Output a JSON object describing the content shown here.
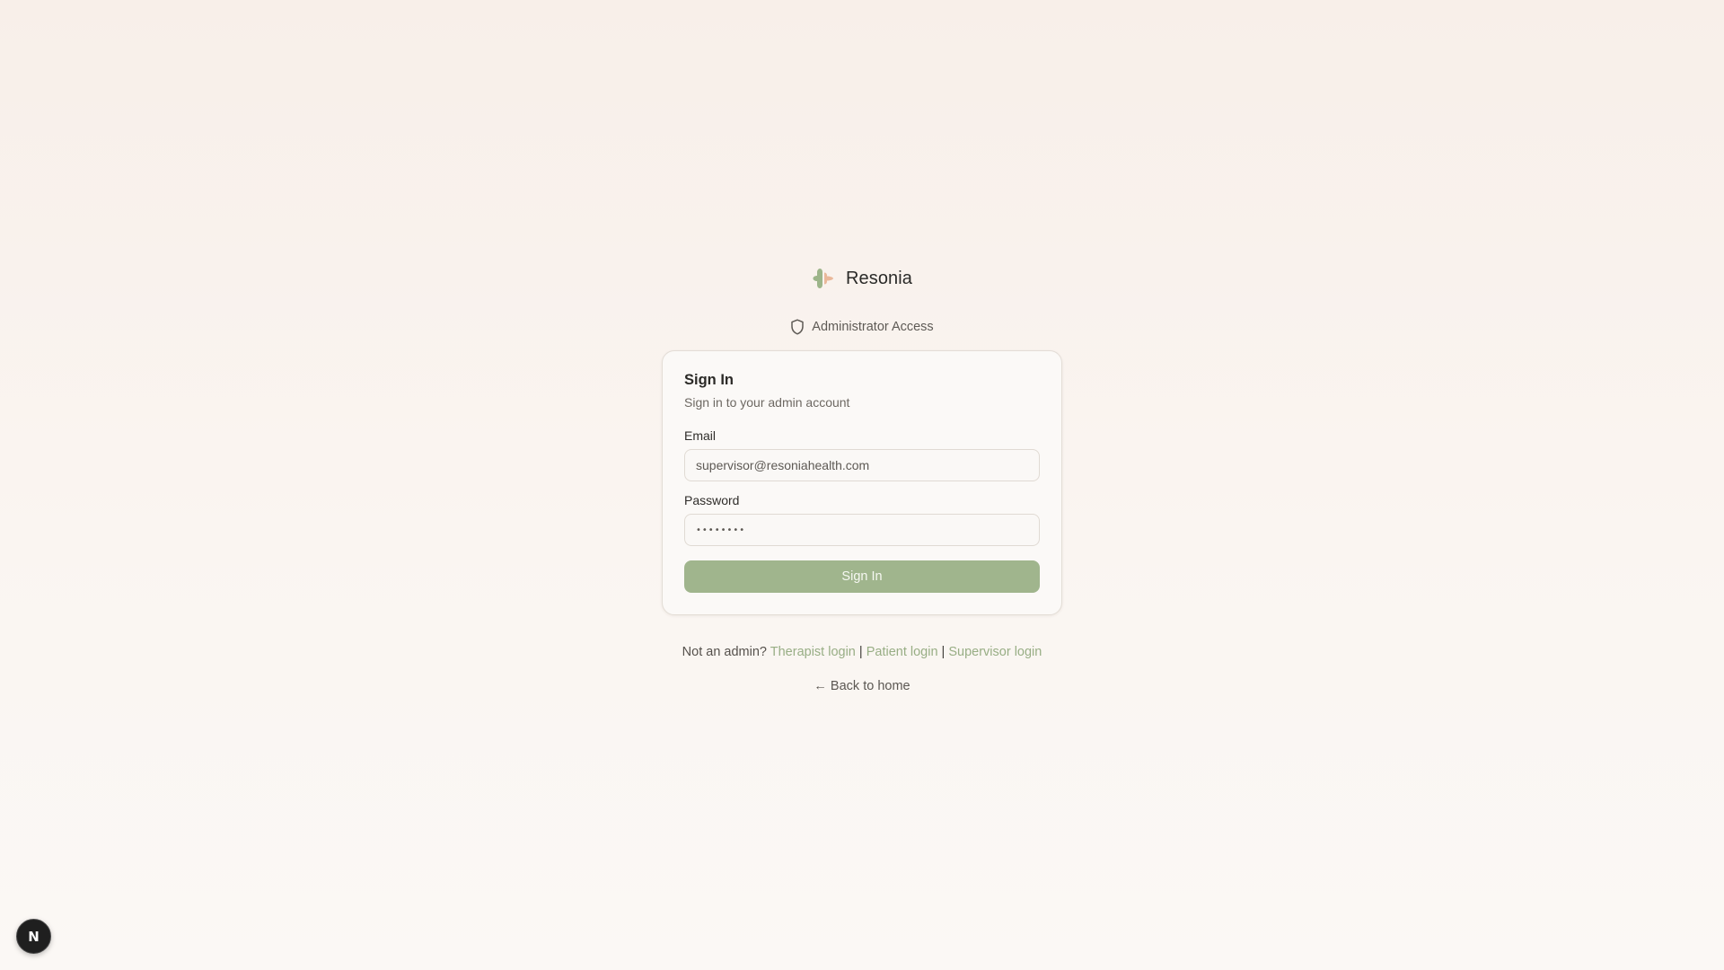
{
  "brand": {
    "name": "Resonia",
    "logo_icon": "leaf-heart-logo",
    "colors": {
      "green": "#9db58a",
      "peach": "#eab89a"
    }
  },
  "access": {
    "icon": "shield-icon",
    "label": "Administrator Access"
  },
  "signin": {
    "title": "Sign In",
    "subtitle": "Sign in to your admin account",
    "email": {
      "label": "Email",
      "value": "supervisor@resoniahealth.com"
    },
    "password": {
      "label": "Password",
      "value": "••••••••"
    },
    "submit_label": "Sign In",
    "submit_color": "#a0b58d"
  },
  "alt_links": {
    "prefix": "Not an admin?",
    "separator": "|",
    "therapist": "Therapist login",
    "patient": "Patient login",
    "supervisor": "Supervisor login",
    "link_color": "#98ae85"
  },
  "back_link": "← Back to home",
  "dev_badge": {
    "label": "N",
    "icon": "nextjs-dev-icon"
  }
}
